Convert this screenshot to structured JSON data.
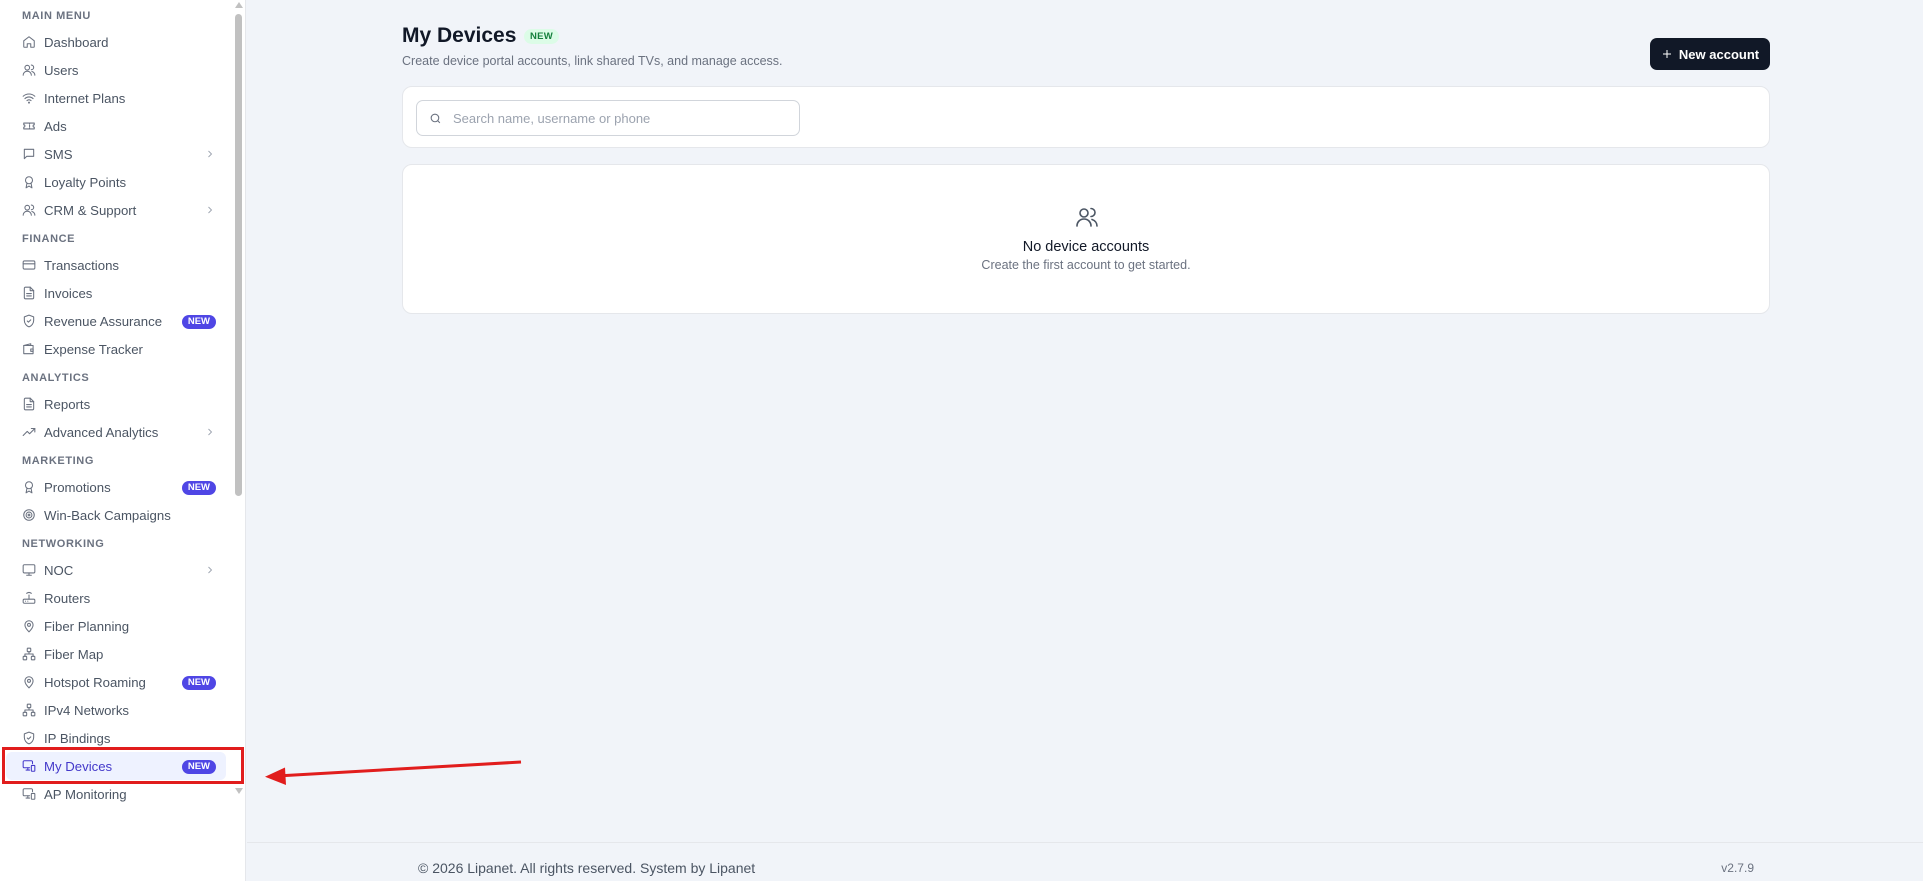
{
  "sidebar": {
    "sections": {
      "main_menu": "MAIN MENU",
      "finance": "FINANCE",
      "analytics": "ANALYTICS",
      "marketing": "MARKETING",
      "networking": "NETWORKING"
    },
    "items": {
      "dashboard": "Dashboard",
      "users": "Users",
      "internet_plans": "Internet Plans",
      "ads": "Ads",
      "sms": "SMS",
      "loyalty_points": "Loyalty Points",
      "crm_support": "CRM & Support",
      "transactions": "Transactions",
      "invoices": "Invoices",
      "revenue_assurance": "Revenue Assurance",
      "expense_tracker": "Expense Tracker",
      "reports": "Reports",
      "advanced_analytics": "Advanced Analytics",
      "promotions": "Promotions",
      "win_back": "Win-Back Campaigns",
      "noc": "NOC",
      "routers": "Routers",
      "fiber_planning": "Fiber Planning",
      "fiber_map": "Fiber Map",
      "hotspot_roaming": "Hotspot Roaming",
      "ipv4_networks": "IPv4 Networks",
      "ip_bindings": "IP Bindings",
      "my_devices": "My Devices",
      "ap_monitoring": "AP Monitoring"
    },
    "badge_new": "NEW",
    "active_item": "My Devices"
  },
  "page": {
    "title": "My Devices",
    "title_badge": "NEW",
    "subtitle": "Create device portal accounts, link shared TVs, and manage access.",
    "new_account_button": "New account"
  },
  "search": {
    "placeholder": "Search name, username or phone",
    "value": ""
  },
  "empty_state": {
    "title": "No device accounts",
    "subtitle": "Create the first account to get started."
  },
  "footer": {
    "copyright": "© 2026 Lipanet. All rights reserved. System by Lipanet",
    "version": "v2.7.9"
  },
  "colors": {
    "accent": "#4f46e5",
    "primary_button": "#111827",
    "annotation": "#e11d1d",
    "background": "#f1f4f9"
  }
}
